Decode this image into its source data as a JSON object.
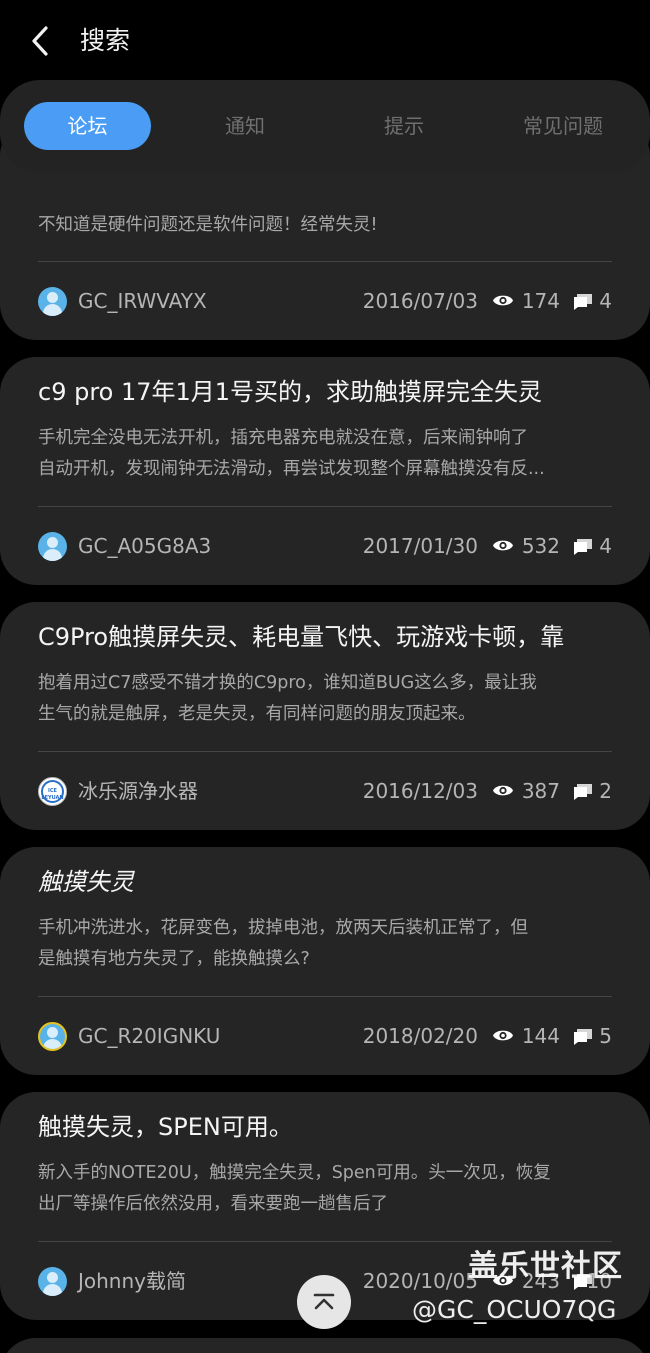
{
  "header": {
    "title": "搜索",
    "back_icon": "chevron-left-icon"
  },
  "tabs": [
    {
      "label": "论坛",
      "active": true
    },
    {
      "label": "通知",
      "active": false
    },
    {
      "label": "提示",
      "active": false
    },
    {
      "label": "常见问题",
      "active": false
    }
  ],
  "posts": [
    {
      "title": "",
      "excerpt": [
        "不知道是硬件问题还是软件问题！经常失灵!"
      ],
      "author": "GC_IRWVAYX",
      "date": "2016/07/03",
      "views": "174",
      "comments": "4"
    },
    {
      "title": "c9 pro 17年1月1号买的，求助触摸屏完全失灵",
      "excerpt": [
        "手机完全没电无法开机，插充电器充电就没在意，后来闹钟响了",
        "自动开机，发现闹钟无法滑动，再尝试发现整个屏幕触摸没有反..."
      ],
      "author": "GC_A05G8A3",
      "date": "2017/01/30",
      "views": "532",
      "comments": "4"
    },
    {
      "title": "C9Pro触摸屏失灵、耗电量飞快、玩游戏卡顿，靠",
      "excerpt": [
        "抱着用过C7感受不错才换的C9pro，谁知道BUG这么多，最让我",
        "生气的就是触屏，老是失灵，有同样问题的朋友顶起来。"
      ],
      "author": "冰乐源净水器",
      "date": "2016/12/03",
      "views": "387",
      "comments": "2"
    },
    {
      "title": "触摸失灵",
      "excerpt": [
        "手机冲洗进水，花屏变色，拔掉电池，放两天后装机正常了，但",
        "是触摸有地方失灵了，能换触摸么?"
      ],
      "author": "GC_R20IGNKU",
      "date": "2018/02/20",
      "views": "144",
      "comments": "5"
    },
    {
      "title": "触摸失灵，SPEN可用。",
      "excerpt": [
        "新入手的NOTE20U，触摸完全失灵，Spen可用。头一次见，恢复",
        "出厂等操作后依然没用，看来要跑一趟售后了"
      ],
      "author": "Johnny载简",
      "date": "2020/10/05",
      "views": "243",
      "comments": "10"
    }
  ],
  "logo_avatar_text": "ICE LEYUAN",
  "watermark": {
    "line1": "盖乐世社区",
    "line2": "@GC_OCUO7QG"
  },
  "icons": {
    "views": "eye-icon",
    "comments": "comment-icon",
    "scroll_top": "arrow-up-to-top-icon"
  },
  "colors": {
    "accent": "#4a9cf5",
    "card": "#252525",
    "background": "#000000"
  }
}
